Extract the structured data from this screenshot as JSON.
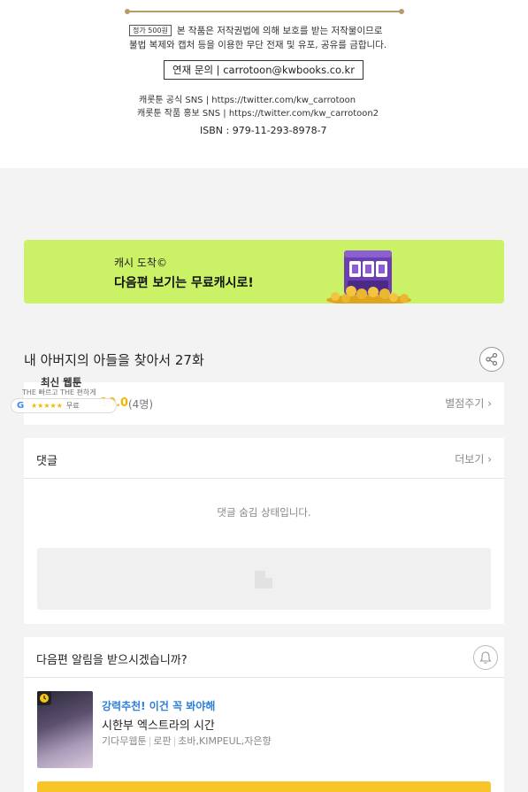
{
  "copyright": {
    "price_tag": "정가 500원",
    "line1": "본 작품은 저작권법에 의해 보호를 받는 저작물이므로",
    "line2": "불법 복제와 캡처 등을 이용한 무단 전재 및 유포, 공유를 금합니다.",
    "contact": "연재 문의 | carrotoon@kwbooks.co.kr",
    "sns1": "캐롯툰 공식 SNS | https://twitter.com/kw_carrotoon",
    "sns2": "캐롯툰 작품 홍보 SNS | https://twitter.com/kw_carrotoon2",
    "isbn": "ISBN : 979-11-293-8978-7"
  },
  "banner": {
    "line1": "캐시 도착©",
    "line2": "다음편 보기는 무료캐시로!",
    "bg_color": "#cbf266"
  },
  "episode": {
    "title": "내 아버지의 아들을 찾아서 27화",
    "share_icon": "share-icon"
  },
  "rating": {
    "value": "10.0",
    "count": "(4명)",
    "rate_label": "별점주기 ›",
    "star_color": "#f5b800"
  },
  "overlay": {
    "title": "최신 웹툰",
    "subtitle": "THE 빠르고 THE 편하게",
    "pill_stars": "★★★★★",
    "pill_label": "무료"
  },
  "comments": {
    "title": "댓글",
    "more_label": "더보기 ›",
    "hidden_message": "댓글 숨김 상태입니다."
  },
  "notify": {
    "question": "다음편 알림을 받으시겠습니까?",
    "bell_icon": "bell-icon"
  },
  "recommend": {
    "tag": "강력추천! 이건 꼭 봐야해",
    "title": "시한부 엑스트라의 시간",
    "meta_platform": "기다무웹툰",
    "meta_genre": "로판",
    "meta_authors": "초바,KIMPEUL,자은향",
    "tag_color": "#2e7fd8",
    "button_color": "#f9c42a"
  }
}
